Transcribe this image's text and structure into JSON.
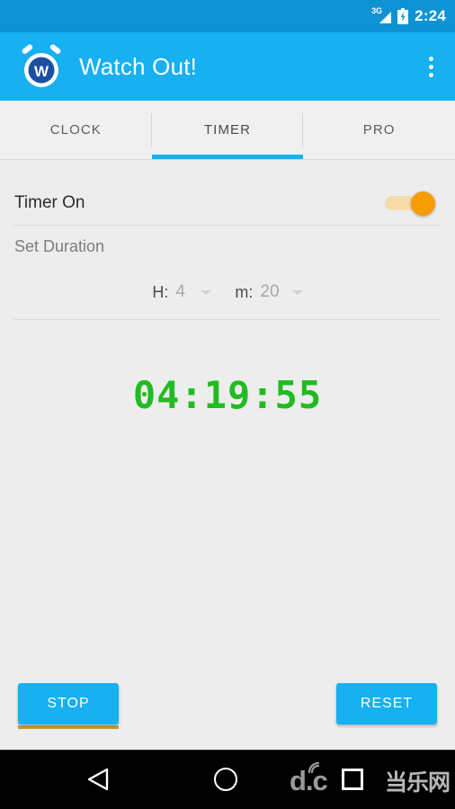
{
  "status_bar": {
    "network_type": "3G",
    "signal_icon": "signal-bars-icon",
    "battery_icon": "battery-charging-icon",
    "clock": "2:24"
  },
  "app_bar": {
    "icon": "alarm-clock-w-icon",
    "title": "Watch Out!",
    "overflow_icon": "overflow-menu-icon",
    "background_color": "#17b0f0"
  },
  "tabs": [
    {
      "label": "CLOCK",
      "active": false
    },
    {
      "label": "TIMER",
      "active": true
    },
    {
      "label": "PRO",
      "active": false
    }
  ],
  "timer": {
    "toggle_label": "Timer On",
    "toggle_state": "on",
    "toggle_color": "#f59c00",
    "set_duration_label": "Set Duration",
    "hours_key": "H:",
    "hours_value": "4",
    "minutes_key": "m:",
    "minutes_value": "20",
    "countdown": "04:19:55",
    "countdown_color": "#22bb22"
  },
  "actions": {
    "stop_label": "STOP",
    "reset_label": "RESET",
    "button_color": "#17b0f0",
    "focus_bar_color": "#c9a13a"
  },
  "nav_bar": {
    "back_icon": "back-triangle-icon",
    "home_icon": "home-circle-icon",
    "recents_icon": "recents-square-icon"
  },
  "watermark": {
    "latin": "d.c",
    "chinese": "当乐网"
  }
}
